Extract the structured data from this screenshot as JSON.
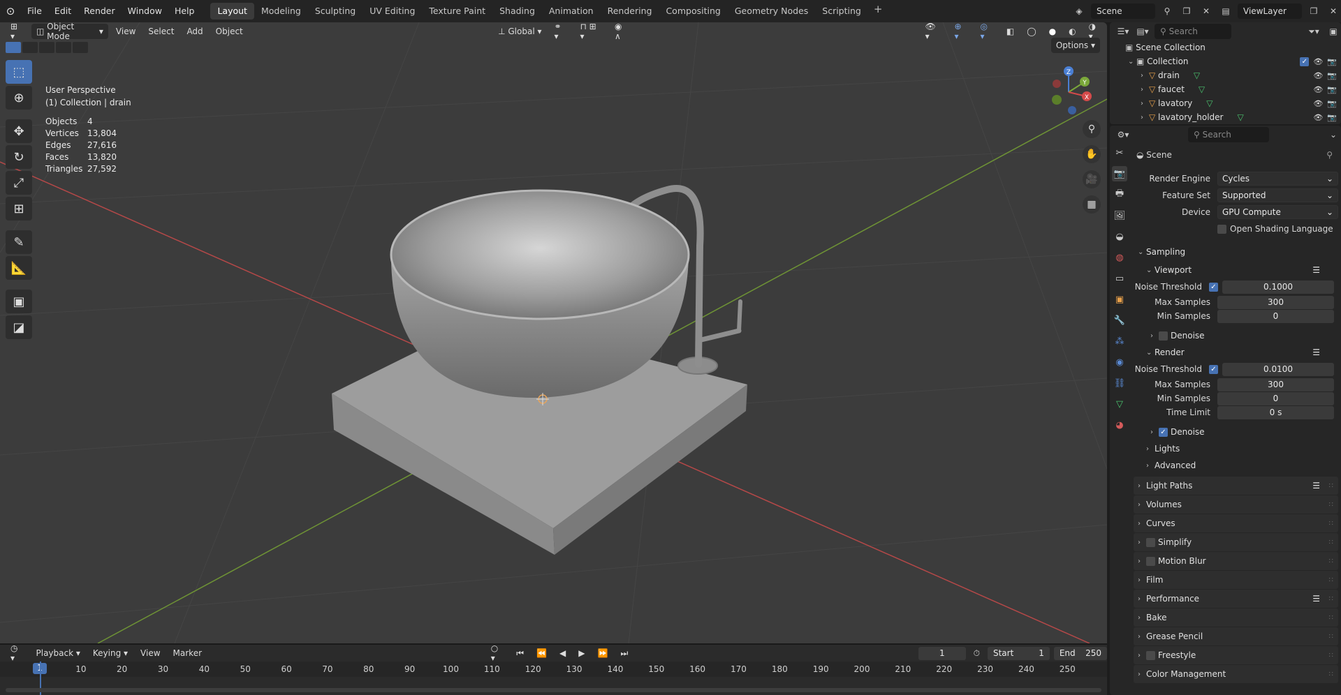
{
  "menu": {
    "logo": "⊙",
    "file": "File",
    "edit": "Edit",
    "render": "Render",
    "window": "Window",
    "help": "Help"
  },
  "workspaces": [
    "Layout",
    "Modeling",
    "Sculpting",
    "UV Editing",
    "Texture Paint",
    "Shading",
    "Animation",
    "Rendering",
    "Compositing",
    "Geometry Nodes",
    "Scripting"
  ],
  "scene": {
    "name": "Scene",
    "view_layer": "ViewLayer"
  },
  "viewport": {
    "mode": "Object Mode",
    "view": "View",
    "select": "Select",
    "add": "Add",
    "object": "Object",
    "orientation": "Global",
    "options": "Options",
    "perspective": "User Perspective",
    "active": "(1) Collection | drain",
    "stats": [
      {
        "k": "Objects",
        "v": "4"
      },
      {
        "k": "Vertices",
        "v": "13,804"
      },
      {
        "k": "Edges",
        "v": "27,616"
      },
      {
        "k": "Faces",
        "v": "13,820"
      },
      {
        "k": "Triangles",
        "v": "27,592"
      }
    ],
    "gizmo": {
      "x": "X",
      "y": "Y",
      "z": "Z"
    }
  },
  "timeline": {
    "playback": "Playback",
    "keying": "Keying",
    "view": "View",
    "marker": "Marker",
    "current": "1",
    "start_label": "Start",
    "start": "1",
    "end_label": "End",
    "end": "250",
    "ticks": [
      "10",
      "20",
      "30",
      "40",
      "50",
      "60",
      "70",
      "80",
      "90",
      "100",
      "110",
      "120",
      "130",
      "140",
      "150",
      "160",
      "170",
      "180",
      "190",
      "200",
      "210",
      "220",
      "230",
      "240",
      "250"
    ],
    "cursor": "1"
  },
  "outliner": {
    "search": "Search",
    "root": "Scene Collection",
    "collection": "Collection",
    "items": [
      "drain",
      "faucet",
      "lavatory",
      "lavatory_holder"
    ]
  },
  "properties": {
    "search": "Search",
    "scene": "Scene",
    "render_engine_label": "Render Engine",
    "render_engine": "Cycles",
    "feature_set_label": "Feature Set",
    "feature_set": "Supported",
    "device_label": "Device",
    "device": "GPU Compute",
    "osl": "Open Shading Language",
    "sampling": "Sampling",
    "viewport": "Viewport",
    "vp_noise_label": "Noise Threshold",
    "vp_noise": "0.1000",
    "vp_max_label": "Max Samples",
    "vp_max": "300",
    "vp_min_label": "Min Samples",
    "vp_min": "0",
    "denoise": "Denoise",
    "render": "Render",
    "r_noise_label": "Noise Threshold",
    "r_noise": "0.0100",
    "r_max_label": "Max Samples",
    "r_max": "300",
    "r_min_label": "Min Samples",
    "r_min": "0",
    "r_time_label": "Time Limit",
    "r_time": "0 s",
    "r_denoise": "Denoise",
    "lights": "Lights",
    "advanced": "Advanced",
    "sections": [
      "Light Paths",
      "Volumes",
      "Curves",
      "Simplify",
      "Motion Blur",
      "Film",
      "Performance",
      "Bake",
      "Grease Pencil",
      "Freestyle",
      "Color Management"
    ]
  },
  "colors": {
    "accent": "#4772b3",
    "x_axis": "#d44a4a",
    "y_axis": "#7ba83a",
    "z_axis": "#4a7fd4"
  }
}
